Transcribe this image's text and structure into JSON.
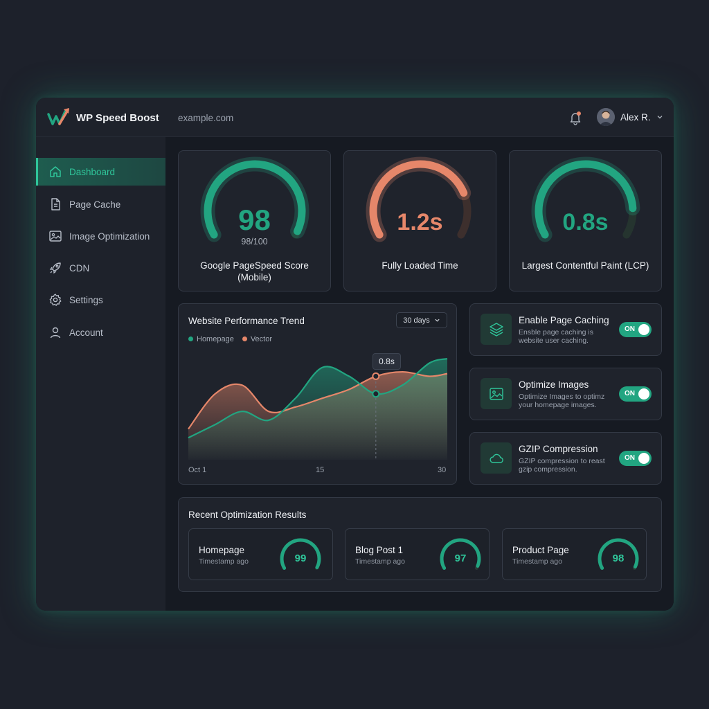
{
  "header": {
    "app_name": "WP Speed Boost",
    "site_url": "example.com",
    "user_name": "Alex R."
  },
  "sidebar": {
    "items": [
      {
        "label": "Dashboard",
        "icon": "home-icon",
        "active": true
      },
      {
        "label": "Page Cache",
        "icon": "document-icon",
        "active": false
      },
      {
        "label": "Image Optimization",
        "icon": "image-icon",
        "active": false
      },
      {
        "label": "CDN",
        "icon": "rocket-icon",
        "active": false
      },
      {
        "label": "Settings",
        "icon": "gear-icon",
        "active": false
      },
      {
        "label": "Account",
        "icon": "user-icon",
        "active": false
      }
    ]
  },
  "metrics": [
    {
      "value": "98",
      "sub": "98/100",
      "label_line1": "Google PageSpeed Score",
      "label_line2": "(Mobile)",
      "fraction": 0.98,
      "color": "#22a581"
    },
    {
      "value": "1.2s",
      "sub": "",
      "label_line1": "Fully Loaded Time",
      "label_line2": "",
      "fraction": 0.78,
      "color": "#e6876a"
    },
    {
      "value": "0.8s",
      "sub": "",
      "label_line1": "Largest Contentful Paint (LCP)",
      "label_line2": "",
      "fraction": 0.86,
      "color": "#22a581"
    }
  ],
  "trend": {
    "title": "Website Performance Trend",
    "range": "30 days",
    "tooltip": "0.8s",
    "x_ticks": [
      "Oct 1",
      "15",
      "30"
    ]
  },
  "chart_data": {
    "type": "area",
    "title": "Website Performance Trend",
    "x": [
      1,
      4,
      7,
      10,
      13,
      16,
      19,
      22,
      25,
      28,
      30
    ],
    "series": [
      {
        "name": "Homepage",
        "color": "#22a581",
        "values": [
          0.25,
          0.4,
          0.55,
          0.45,
          0.7,
          1.05,
          0.95,
          0.75,
          0.85,
          1.1,
          1.15
        ]
      },
      {
        "name": "Vector",
        "color": "#e6876a",
        "values": [
          0.35,
          0.75,
          0.85,
          0.55,
          0.6,
          0.7,
          0.8,
          0.95,
          1.0,
          0.95,
          0.98
        ]
      }
    ],
    "highlight": {
      "x": 22,
      "label": "0.8s"
    }
  },
  "toggles": [
    {
      "title": "Enable Page Caching",
      "desc_line1": "Ensble page caching is",
      "desc_line2": "website user caching.",
      "state": "ON",
      "icon": "layers-icon"
    },
    {
      "title": "Optimize Images",
      "desc_line1": "Optimize Images to optimz",
      "desc_line2": "your homepage images.",
      "state": "ON",
      "icon": "image-icon"
    },
    {
      "title": "GZIP Compression",
      "desc_line1": "GZIP compression to reast",
      "desc_line2": "gzip  compression.",
      "state": "ON",
      "icon": "cloud-icon"
    }
  ],
  "recent": {
    "title": "Recent Optimization Results",
    "items": [
      {
        "name": "Homepage",
        "time": "Timestamp ago",
        "score": "99",
        "fraction": 0.99
      },
      {
        "name": "Blog Post 1",
        "time": "Timestamp ago",
        "score": "97",
        "fraction": 0.97
      },
      {
        "name": "Product Page",
        "time": "Timestamp ago",
        "score": "98",
        "fraction": 0.98
      }
    ]
  },
  "colors": {
    "accent": "#22a581",
    "accent_bright": "#2fc59a",
    "warn": "#e6876a",
    "background": "#161a22",
    "card": "#1f232c"
  }
}
